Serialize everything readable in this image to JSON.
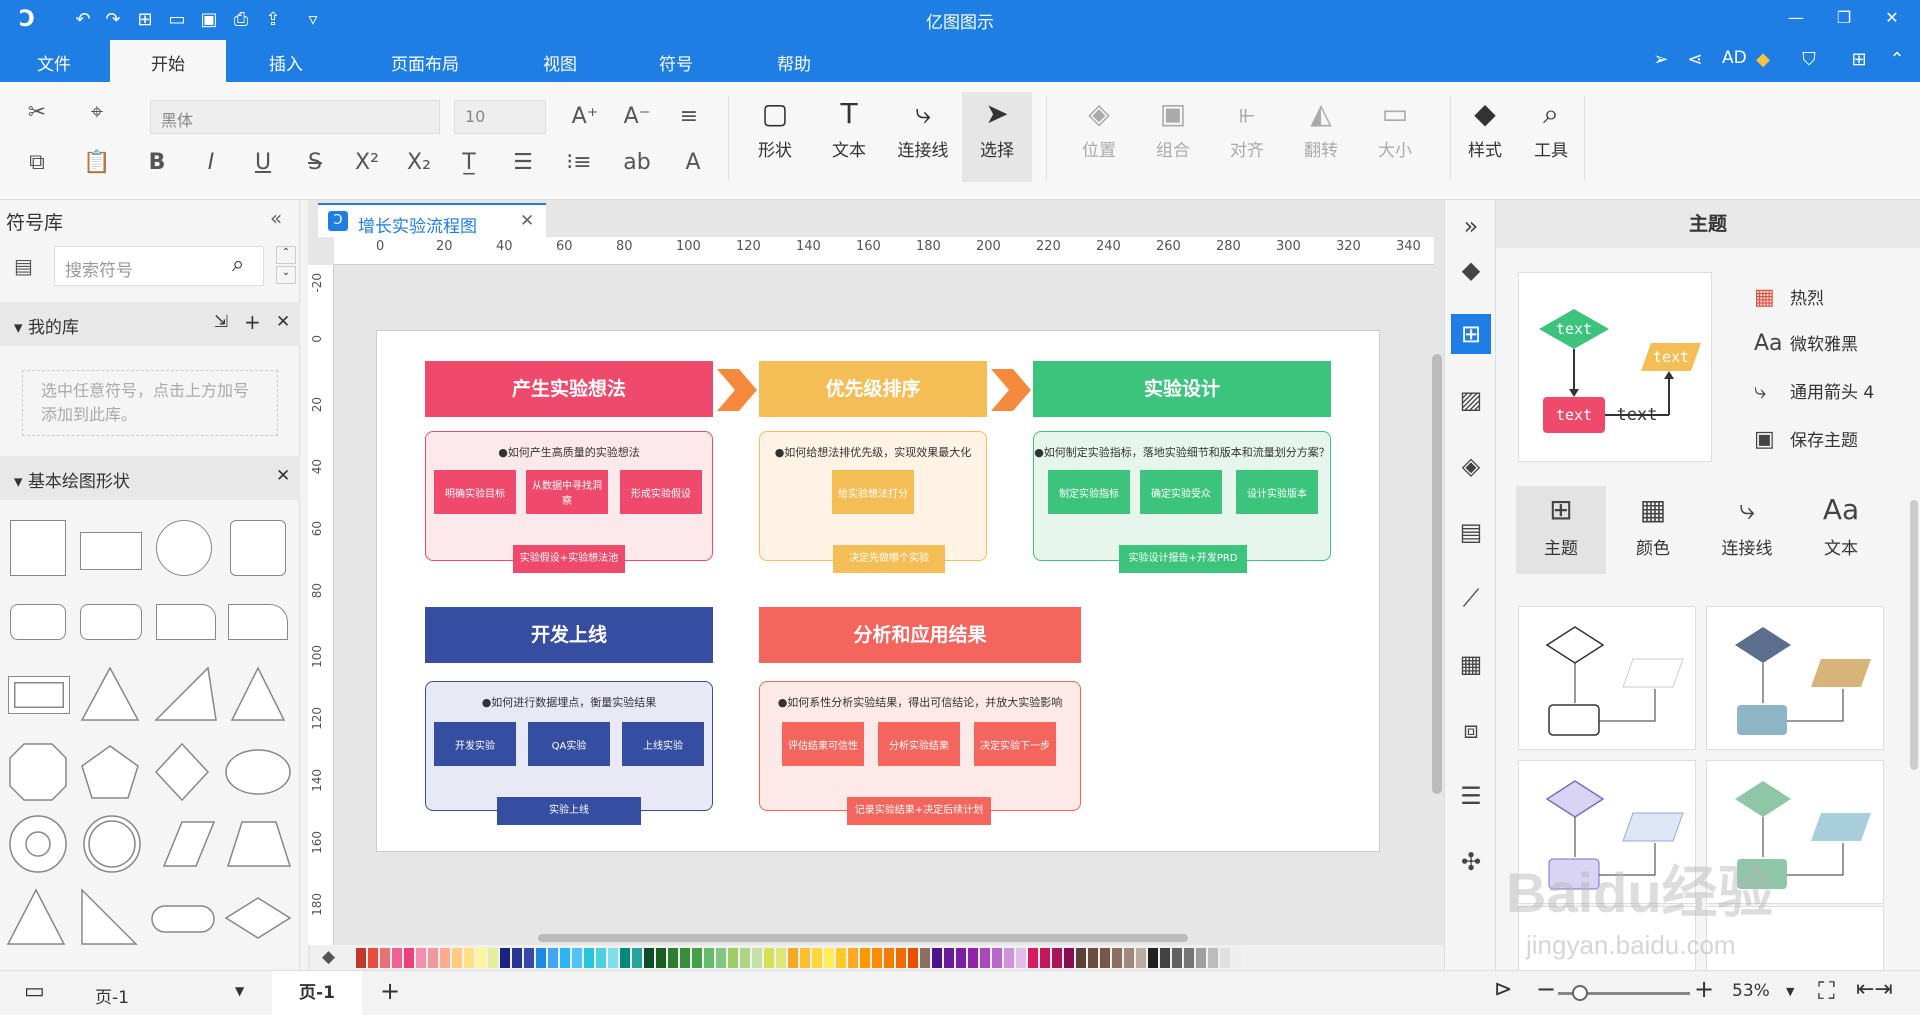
{
  "window": {
    "title": "亿图图示"
  },
  "menu": {
    "file": "文件",
    "tabs": [
      "开始",
      "插入",
      "页面布局",
      "视图",
      "符号",
      "帮助"
    ],
    "active_tab": "开始"
  },
  "user": {
    "name": "AD"
  },
  "ribbon": {
    "font_name": "黑体",
    "font_size": "10",
    "big_buttons": [
      "形状",
      "文本",
      "连接线",
      "选择",
      "位置",
      "组合",
      "对齐",
      "翻转",
      "大小",
      "样式",
      "工具"
    ]
  },
  "left_panel": {
    "title": "符号库",
    "search_placeholder": "搜索符号",
    "my_library": "我的库",
    "my_library_hint": "选中任意符号，点击上方加号添加到此库。",
    "basic_shapes": "基本绘图形状"
  },
  "document": {
    "tab_name": "增长实验流程图"
  },
  "ruler": {
    "h": [
      "0",
      "20",
      "40",
      "60",
      "80",
      "100",
      "120",
      "140",
      "160",
      "180",
      "200",
      "220",
      "240",
      "260",
      "280",
      "300",
      "320",
      "340"
    ],
    "v": [
      "-20",
      "0",
      "20",
      "40",
      "60",
      "80",
      "100",
      "120",
      "140",
      "160",
      "180"
    ]
  },
  "diagram": {
    "stage1": {
      "title": "产生实验想法",
      "question": "●如何产生高质量的实验想法",
      "items": [
        "明确实验目标",
        "从数据中寻找洞察",
        "形成实验假设"
      ],
      "footer": "实验假设+实验想法池",
      "color": "#ef4a6b"
    },
    "stage2": {
      "title": "优先级排序",
      "question": "●如何给想法排优先级，实现效果最大化",
      "items": [
        "给实验想法打分"
      ],
      "footer": "决定先做哪个实验",
      "color": "#f5bd55"
    },
    "stage3": {
      "title": "实验设计",
      "question": "●如何制定实验指标，落地实验细节和版本和流量划分方案？",
      "items": [
        "制定实验指标",
        "确定实验受众",
        "设计实验版本"
      ],
      "footer": "实验设计报告+开发PRD",
      "color": "#3cc47c"
    },
    "stage4": {
      "title": "开发上线",
      "question": "●如何进行数据埋点，衡量实验结果",
      "items": [
        "开发实验",
        "QA实验",
        "上线实验"
      ],
      "footer": "实验上线",
      "color": "#354ea2"
    },
    "stage5": {
      "title": "分析和应用结果",
      "question": "●如何系性分析实验结果，得出可信结论，并放大实验影响",
      "items": [
        "评估结果可信性",
        "分析实验结果",
        "决定实验下一步"
      ],
      "footer": "记录实验结果+决定后续计划",
      "color": "#f3655d"
    }
  },
  "right_panel": {
    "title": "主题",
    "options": [
      "热烈",
      "微软雅黑",
      "通用箭头 4",
      "保存主题"
    ],
    "tabs": [
      "主题",
      "颜色",
      "连接线",
      "文本"
    ],
    "preview_text": "text"
  },
  "status_bar": {
    "page_select": "页-1",
    "page_tab": "页-1",
    "zoom": "53%"
  },
  "watermark": {
    "brand": "Baidu经验",
    "url": "jingyan.baidu.com"
  },
  "palette_colors": [
    "#c0392b",
    "#e74c3c",
    "#e57373",
    "#f06292",
    "#ec407a",
    "#f48fb1",
    "#ef9a9a",
    "#ffab91",
    "#ffcc80",
    "#ffe082",
    "#fff59d",
    "#e6ee9c",
    "#1a237e",
    "#283593",
    "#3949ab",
    "#1e88e5",
    "#42a5f5",
    "#29b6f6",
    "#4fc3f7",
    "#26c6da",
    "#4dd0e1",
    "#80deea",
    "#00897b",
    "#26a69a",
    "#0d4d2a",
    "#1b5e20",
    "#2e7d32",
    "#388e3c",
    "#43a047",
    "#66bb6a",
    "#81c784",
    "#9ccc65",
    "#aed581",
    "#c5e1a5",
    "#d4e157",
    "#dce775",
    "#f9a825",
    "#fbc02d",
    "#fdd835",
    "#ffee58",
    "#ffca28",
    "#ffa726",
    "#ff9800",
    "#fb8c00",
    "#f57c00",
    "#ef6c00",
    "#e65100",
    "#8d6e63",
    "#4a148c",
    "#6a1b9a",
    "#7b1fa2",
    "#8e24aa",
    "#ab47bc",
    "#ba68c8",
    "#ce93d8",
    "#e1bee7",
    "#d81b60",
    "#c2185b",
    "#ad1457",
    "#880e4f",
    "#5d4037",
    "#6d4c41",
    "#795548",
    "#8d6e63",
    "#a1887f",
    "#bcaaa4",
    "#212121",
    "#424242",
    "#616161",
    "#757575",
    "#9e9e9e",
    "#bdbdbd",
    "#e0e0e0",
    "#eeeeee"
  ]
}
